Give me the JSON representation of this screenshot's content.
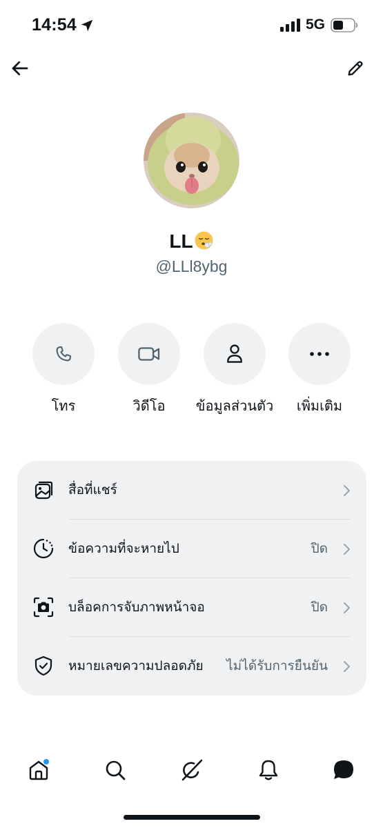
{
  "status_bar": {
    "time": "14:54",
    "network": "5G",
    "icons": [
      "location-arrow-icon",
      "signal-bars-icon",
      "battery-icon"
    ]
  },
  "header": {
    "back_icon": "back-arrow-icon",
    "edit_icon": "pencil-icon"
  },
  "profile": {
    "display_name": "LL",
    "name_emoji": "😮‍💨",
    "handle": "@LLl8ybg"
  },
  "actions": [
    {
      "label": "โทร",
      "icon": "phone-icon"
    },
    {
      "label": "วิดีโอ",
      "icon": "video-camera-icon"
    },
    {
      "label": "ข้อมูลส่วนตัว",
      "icon": "person-icon"
    },
    {
      "label": "เพิ่มเติม",
      "icon": "more-dots-icon"
    }
  ],
  "settings": [
    {
      "label": "สื่อที่แชร์",
      "value": "",
      "icon": "media-images-icon"
    },
    {
      "label": "ข้อความที่จะหายไป",
      "value": "ปิด",
      "icon": "timer-clock-icon"
    },
    {
      "label": "บล็อคการจับภาพหน้าจอ",
      "value": "ปิด",
      "icon": "screenshot-camera-icon"
    },
    {
      "label": "หมายเลขความปลอดภัย",
      "value": "ไม่ได้รับการยืนยัน",
      "icon": "shield-check-icon"
    }
  ],
  "tabbar": [
    {
      "name": "home",
      "icon": "home-icon",
      "has_badge": true
    },
    {
      "name": "search",
      "icon": "search-icon"
    },
    {
      "name": "grok",
      "icon": "grok-icon"
    },
    {
      "name": "notifications",
      "icon": "bell-icon"
    },
    {
      "name": "messages",
      "icon": "message-bubble-icon",
      "active": true
    }
  ],
  "colors": {
    "text": "#0f1419",
    "secondary": "#536471",
    "surface": "#f0f1f2",
    "badge": "#1d9bf0"
  }
}
